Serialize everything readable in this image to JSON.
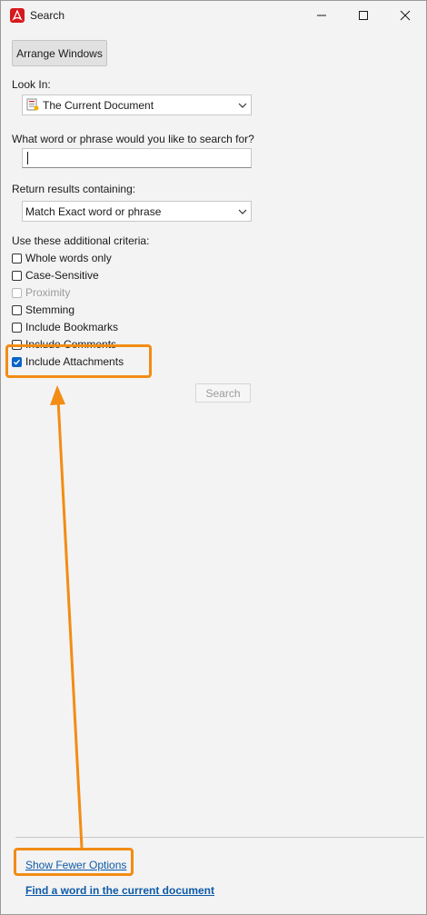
{
  "window": {
    "title": "Search",
    "app_icon": "acrobat-icon",
    "controls": {
      "minimize_icon": "minimize-icon",
      "maximize_icon": "maximize-icon",
      "close_icon": "close-icon"
    }
  },
  "toolbar": {
    "arrange_label": "Arrange Windows"
  },
  "look_in": {
    "label": "Look In:",
    "selected": "The Current Document",
    "icon": "document-icon"
  },
  "search_phrase": {
    "label": "What word or phrase would you like to search for?",
    "value": ""
  },
  "return_results": {
    "label": "Return results containing:",
    "selected": "Match Exact word or phrase"
  },
  "criteria": {
    "label": "Use these additional criteria:",
    "items": [
      {
        "label": "Whole words only",
        "checked": false,
        "disabled": false
      },
      {
        "label": "Case-Sensitive",
        "checked": false,
        "disabled": false
      },
      {
        "label": "Proximity",
        "checked": false,
        "disabled": true
      },
      {
        "label": "Stemming",
        "checked": false,
        "disabled": false
      },
      {
        "label": "Include Bookmarks",
        "checked": false,
        "disabled": false
      },
      {
        "label": "Include Comments",
        "checked": false,
        "disabled": false
      },
      {
        "label": "Include Attachments",
        "checked": true,
        "disabled": false
      }
    ]
  },
  "search_button": {
    "label": "Search",
    "enabled": false
  },
  "footer": {
    "fewer_options": "Show Fewer Options",
    "find_word": "Find a word in the current document"
  },
  "colors": {
    "highlight": "#f28c14",
    "link": "#0e5aa7",
    "checkbox_checked": "#0a64c8"
  }
}
